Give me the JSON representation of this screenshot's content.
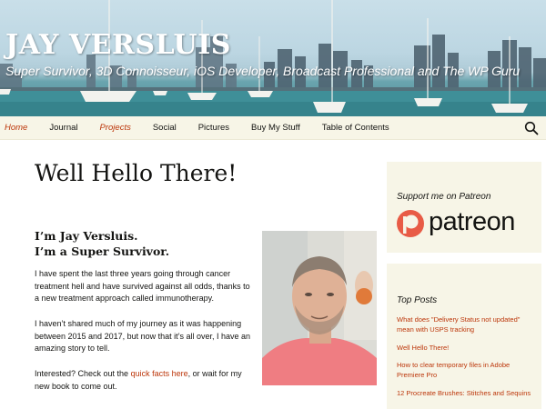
{
  "header": {
    "title": "JAY VERSLUIS",
    "tagline": "Super Survivor, 3D Connoisseur, iOS Developer, Broadcast Professional and The WP Guru"
  },
  "nav": {
    "items": [
      {
        "label": "Home",
        "accent": true
      },
      {
        "label": "Journal",
        "accent": false
      },
      {
        "label": "Projects",
        "accent": true
      },
      {
        "label": "Social",
        "accent": false
      },
      {
        "label": "Pictures",
        "accent": false
      },
      {
        "label": "Buy My Stuff",
        "accent": false
      },
      {
        "label": "Table of Contents",
        "accent": false
      }
    ],
    "search_icon": "search-icon"
  },
  "content": {
    "page_title": "Well Hello There!",
    "intro_line1": "I’m Jay Versluis.",
    "intro_line2": "I’m a Super Survivor.",
    "p1": "I have spent the last three years going through cancer treatment hell and have survived against all odds, thanks to a new treatment approach called immunotherapy.",
    "p2": "I haven’t shared much of my journey as it was happening between 2015 and 2017, but now that it’s all over, I have an amazing story to tell.",
    "p3_before": "Interested? Check out the ",
    "p3_link": "quick facts here",
    "p3_after": ", or wait for my new book to come out."
  },
  "sidebar": {
    "patreon_title": "Support me on Patreon",
    "patreon_logo": "patreon",
    "top_posts_title": "Top Posts",
    "top_posts": [
      "What does \"Delivery Status not updated\" mean with USPS tracking",
      "Well Hello There!",
      "How to clear temporary files in Adobe Premiere Pro",
      "12 Procreate Brushes: Stitches and Sequins"
    ]
  },
  "colors": {
    "accent": "#bc360a",
    "nav_bg": "#f7f5e7",
    "patreon_orange": "#e85b46"
  }
}
